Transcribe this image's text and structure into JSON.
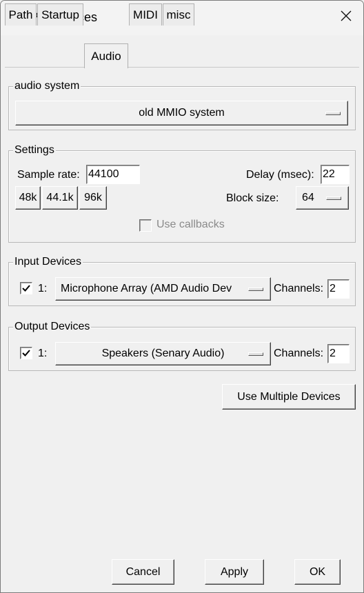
{
  "window": {
    "title": "Preferences"
  },
  "tabs": [
    {
      "label": "Path"
    },
    {
      "label": "Startup"
    },
    {
      "label": "Audio",
      "active": true
    },
    {
      "label": "MIDI"
    },
    {
      "label": "misc"
    }
  ],
  "audio_system": {
    "legend": "audio system",
    "selected": "old MMIO system"
  },
  "settings": {
    "legend": "Settings",
    "sample_rate_label": "Sample rate:",
    "sample_rate_value": "44100",
    "rate_buttons": [
      "48k",
      "44.1k",
      "96k"
    ],
    "delay_label": "Delay (msec):",
    "delay_value": "22",
    "block_size_label": "Block size:",
    "block_size_value": "64",
    "use_callbacks_label": "Use callbacks"
  },
  "input_devices": {
    "legend": "Input Devices",
    "index": "1:",
    "device": "Microphone Array (AMD Audio Dev",
    "channels_label": "Channels:",
    "channels_value": "2",
    "checked": true
  },
  "output_devices": {
    "legend": "Output Devices",
    "index": "1:",
    "device": "Speakers (Senary Audio)",
    "channels_label": "Channels:",
    "channels_value": "2",
    "checked": true
  },
  "buttons": {
    "multiple_devices": "Use Multiple Devices",
    "cancel": "Cancel",
    "apply": "Apply",
    "ok": "OK"
  },
  "icons": {
    "app": "pd-app-icon",
    "close": "close-icon",
    "check": "check-icon"
  }
}
